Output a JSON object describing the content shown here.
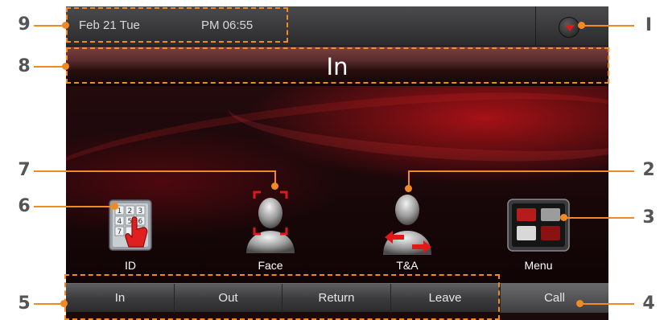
{
  "status_bar": {
    "date": "Feb 21 Tue",
    "time": "PM 06:55"
  },
  "mode_bar": {
    "mode": "In"
  },
  "icons": {
    "id": {
      "label": "ID",
      "keypad_digits": [
        "1",
        "2",
        "3",
        "4",
        "5",
        "6",
        "7"
      ]
    },
    "face": {
      "label": "Face"
    },
    "ta": {
      "label": "T&A"
    },
    "menu": {
      "label": "Menu"
    }
  },
  "function_keys": [
    "In",
    "Out",
    "Return",
    "Leave"
  ],
  "call_key": "Call",
  "callouts": {
    "c1": "I",
    "c2": "2",
    "c3": "3",
    "c4": "4",
    "c5": "5",
    "c6": "6",
    "c7": "7",
    "c8": "8",
    "c9": "9"
  },
  "colors": {
    "accent_red": "#e01818",
    "callout_orange": "#f08a24"
  }
}
